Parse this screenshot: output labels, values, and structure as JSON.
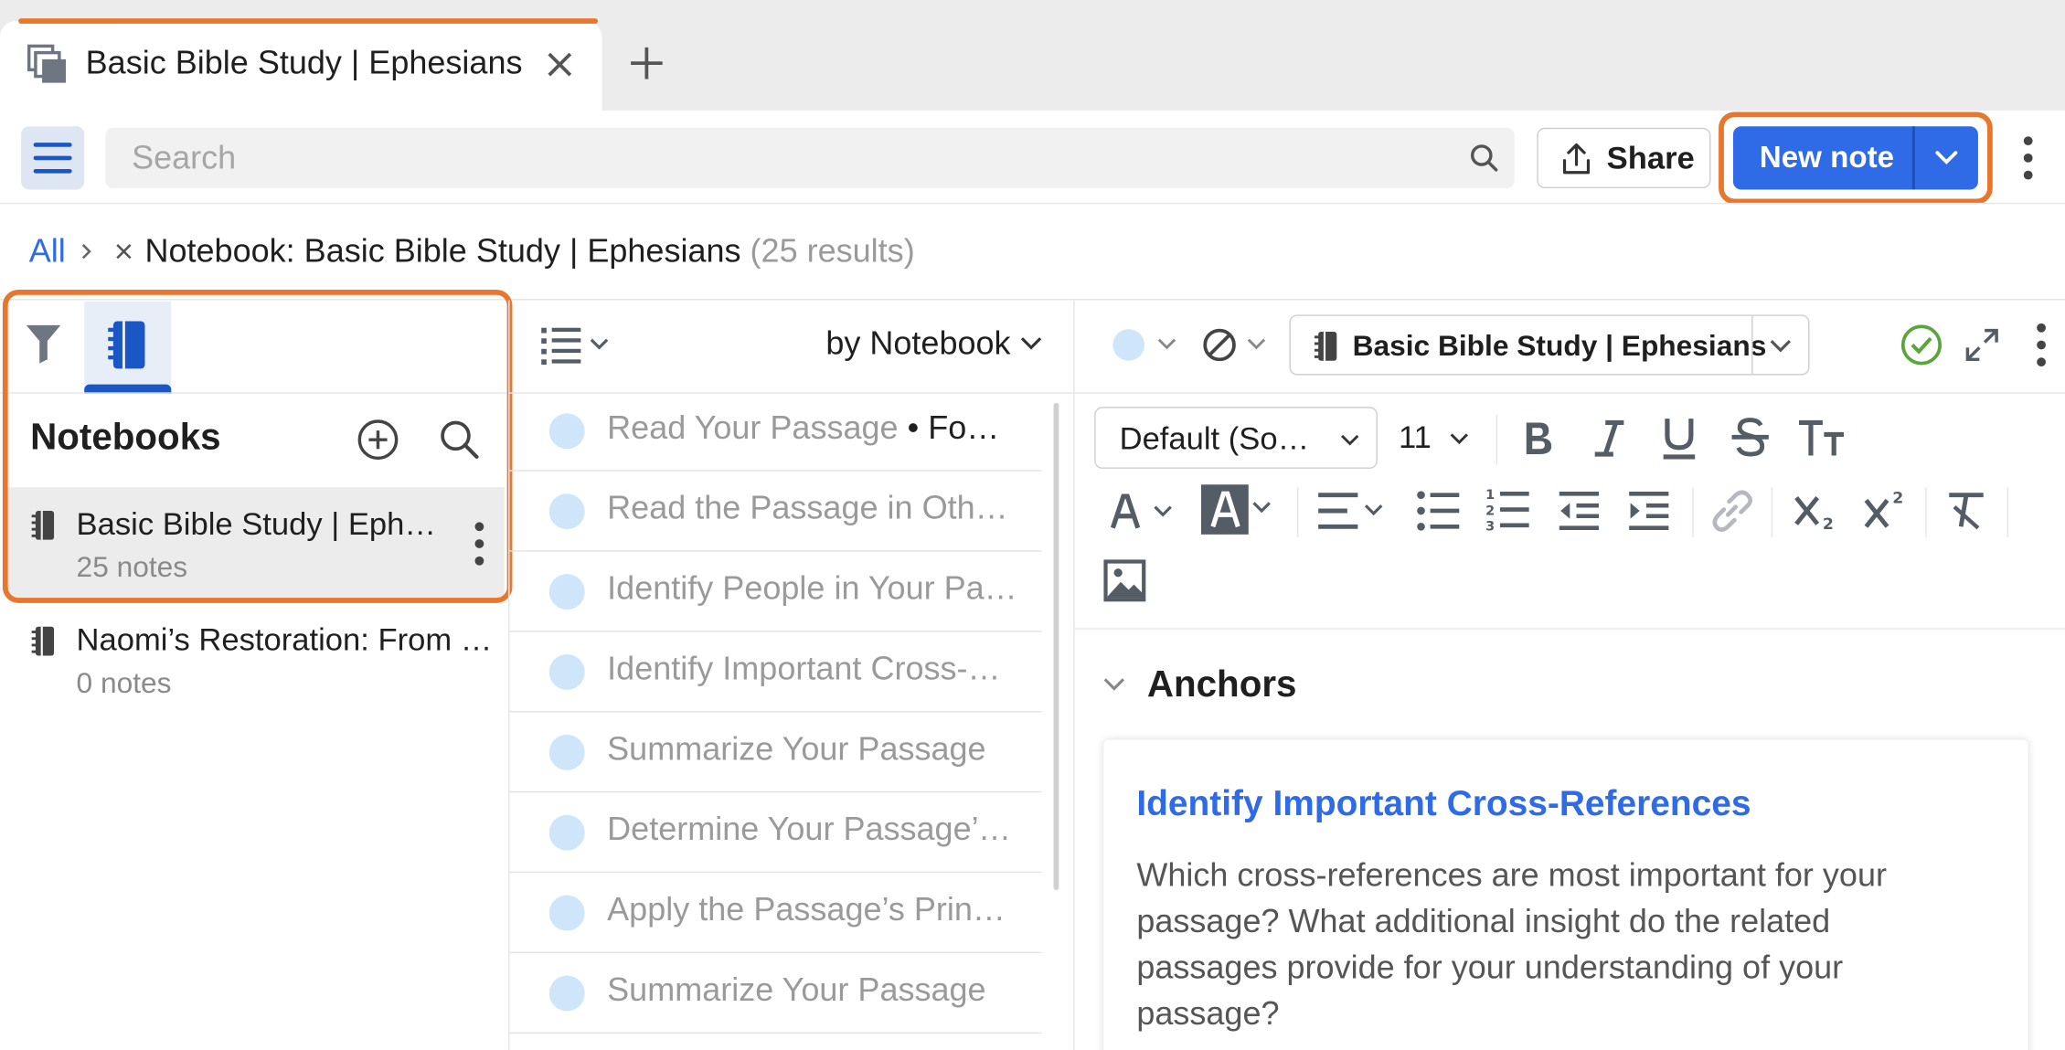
{
  "tab": {
    "title": "Basic Bible Study | Ephesians"
  },
  "toolbar": {
    "search_placeholder": "Search",
    "share_label": "Share",
    "new_note_label": "New note"
  },
  "breadcrumb": {
    "all": "All",
    "filter": "Notebook: Basic Bible Study | Ephesians",
    "results": "(25 results)"
  },
  "notebooks_panel": {
    "title": "Notebooks",
    "items": [
      {
        "name": "Basic Bible Study | Ephesians",
        "count": "25 notes",
        "selected": true
      },
      {
        "name": "Naomi’s Restoration: From Bitterness to Blessing",
        "count": "0 notes",
        "selected": false
      }
    ]
  },
  "notes_list": {
    "sort_label": "by Notebook",
    "items": [
      {
        "title": "Read Your Passage",
        "suffix": "Fo…"
      },
      {
        "title": "Read the Passage in Other Translations"
      },
      {
        "title": "Identify People in Your Passage"
      },
      {
        "title": "Identify Important Cross-References"
      },
      {
        "title": "Summarize Your Passage"
      },
      {
        "title": "Determine Your Passage’s Principles"
      },
      {
        "title": "Apply the Passage’s Principles"
      },
      {
        "title": "Summarize Your Passage"
      }
    ]
  },
  "editor": {
    "notebook_select": "Basic Bible Study | Ephesians",
    "font_family": "Default (So…",
    "font_size": "11",
    "anchors_heading": "Anchors",
    "card": {
      "title": "Identify Important Cross-References",
      "body": "Which cross-references are most important for your passage? What additional insight do the related passages provide for your understanding of your passage?"
    }
  },
  "colors": {
    "accent_blue": "#2f6be6",
    "highlight_orange": "#e8762d",
    "status_green": "#5aa53c"
  }
}
